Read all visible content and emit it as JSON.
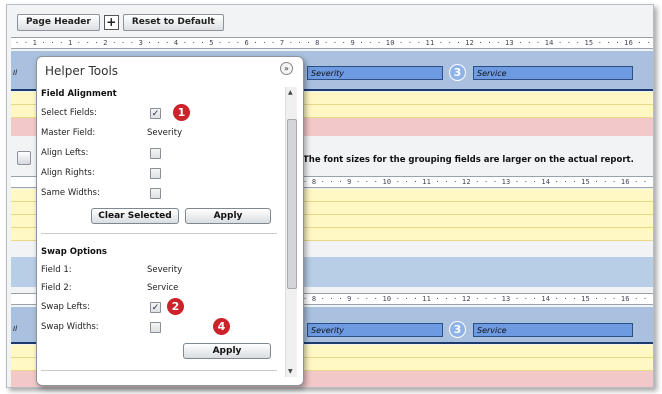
{
  "toolbar": {
    "page_header_label": "Page Header",
    "plus_symbol": "+",
    "reset_label": "Reset to Default"
  },
  "rulers": {
    "top": "· · 1 · · · 1 · · · 2 · · · 3 · · · 4 · · · 5 · · · 6 · · · 7 · · · 8 · · · 9 · · · 10 · · · 11 · · · 12 · · · 13 · · · 14 · · · 15 · · · 16 · · · 17 ·",
    "middle": "· 8 · · · 9 · · · 10 · · · 11 · · · 12 · · · 13 · · · 14 · · · 15 · · · 16 · · · 17 ·",
    "lower": "· 8 · · · 9 · · · 10 · · · 11 · · · 12 · · · 13 · · · 14 · · · 15 · · · 16 · · · 17 ·"
  },
  "report": {
    "top_fields": [
      "Severity",
      "Service"
    ],
    "bottom_fields": [
      "Severity",
      "Service"
    ],
    "side_label_top": "Il",
    "side_label_mid": "Fo",
    "side_label_bottom": "Il",
    "note": "The font sizes for the grouping fields are larger on the actual report."
  },
  "badges": {
    "one": "1",
    "two": "2",
    "three": "3",
    "four": "4"
  },
  "helper": {
    "title": "Helper Tools",
    "collapse_glyph": "»",
    "field_alignment": {
      "title": "Field Alignment",
      "select_fields_label": "Select Fields:",
      "master_field_label": "Master Field:",
      "master_field_value": "Severity",
      "align_lefts_label": "Align Lefts:",
      "align_rights_label": "Align Rights:",
      "same_widths_label": "Same Widths:",
      "clear_selected_label": "Clear Selected",
      "apply_label": "Apply"
    },
    "swap_options": {
      "title": "Swap Options",
      "field1_label": "Field 1:",
      "field1_value": "Severity",
      "field2_label": "Field 2:",
      "field2_value": "Service",
      "swap_lefts_label": "Swap Lefts:",
      "swap_widths_label": "Swap Widths:",
      "apply_label": "Apply"
    },
    "checkboxes": {
      "select_fields": true,
      "align_lefts": false,
      "align_rights": false,
      "same_widths": false,
      "swap_lefts": true,
      "swap_widths": false
    }
  },
  "colors": {
    "badge_red": "#cc2229",
    "badge_blue": "#8fb3e8",
    "field_blue": "#6d9ae0",
    "band_yellow": "#fff8c4",
    "band_pink": "#f2c8c8"
  }
}
